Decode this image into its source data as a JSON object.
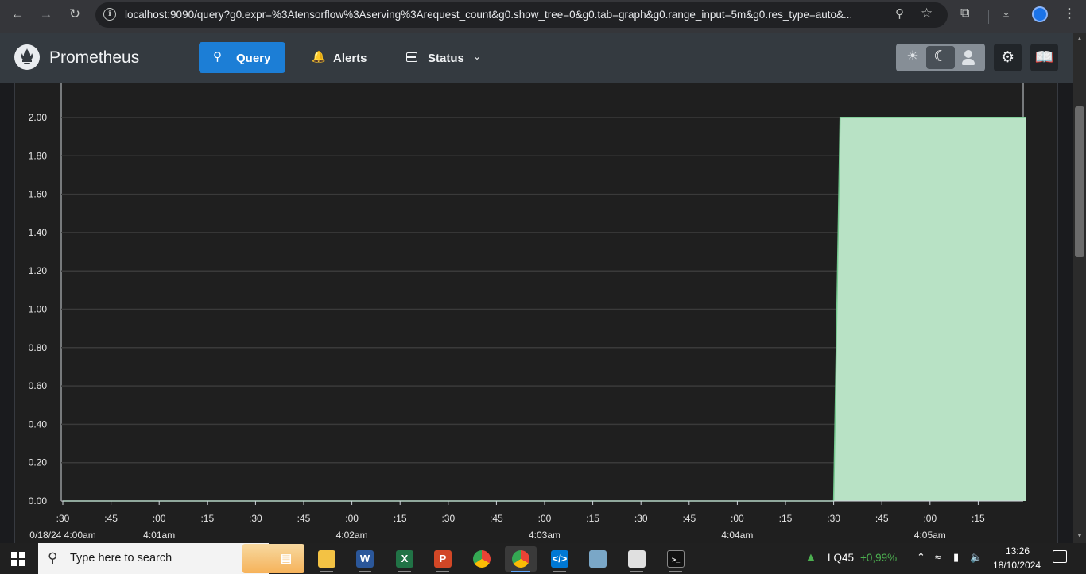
{
  "browser": {
    "url_host": "localhost",
    "url_rest": ":9090/query?g0.expr=%3Atensorflow%3Aserving%3Arequest_count&g0.show_tree=0&g0.tab=graph&g0.range_input=5m&g0.res_type=auto&...",
    "icons": [
      "back-icon",
      "forward-icon",
      "reload-icon",
      "info-icon",
      "zoom-icon",
      "star-icon",
      "extensions-icon",
      "download-icon",
      "profile-icon",
      "menu-icon"
    ]
  },
  "nav": {
    "brand": "Prometheus",
    "query_label": "Query",
    "alerts_label": "Alerts",
    "status_label": "Status",
    "active_tab": "Query",
    "accent_color": "#1c7ed6"
  },
  "chart_data": {
    "type": "area",
    "x_tick_labels": [
      ":30",
      ":45",
      ":00",
      ":15",
      ":30",
      ":45",
      ":00",
      ":15",
      ":30",
      ":45",
      ":00",
      ":15",
      ":30",
      ":45",
      ":00",
      ":15",
      ":30",
      ":45",
      ":00",
      ":15"
    ],
    "x_major_labels": [
      {
        "tick_index": 0,
        "label": "0/18/24 4:00am"
      },
      {
        "tick_index": 2,
        "label": "4:01am"
      },
      {
        "tick_index": 6,
        "label": "4:02am"
      },
      {
        "tick_index": 10,
        "label": "4:03am"
      },
      {
        "tick_index": 14,
        "label": "4:04am"
      },
      {
        "tick_index": 18,
        "label": "4:05am"
      }
    ],
    "y_ticks": [
      "0.00",
      "0.20",
      "0.40",
      "0.60",
      "0.80",
      "1.00",
      "1.20",
      "1.40",
      "1.60",
      "1.80",
      "2.00"
    ],
    "ylim": [
      0,
      2
    ],
    "xlim_seconds": [
      0,
      300
    ],
    "series": [
      {
        "points": [
          [
            0,
            0
          ],
          [
            240,
            0
          ],
          [
            242,
            2
          ],
          [
            300,
            2
          ]
        ],
        "color": "#b8e2c5",
        "line_color": "#74c98e"
      }
    ],
    "grid": true
  },
  "taskbar": {
    "search_placeholder": "Type here to search",
    "apps": [
      "task-view",
      "file-explorer",
      "word",
      "excel",
      "powerpoint",
      "chrome",
      "chrome-active",
      "vscode",
      "notepad",
      "app-window",
      "terminal"
    ],
    "stock_name": "LQ45",
    "stock_change": "+0,99%",
    "time": "13:26",
    "date": "18/10/2024"
  }
}
